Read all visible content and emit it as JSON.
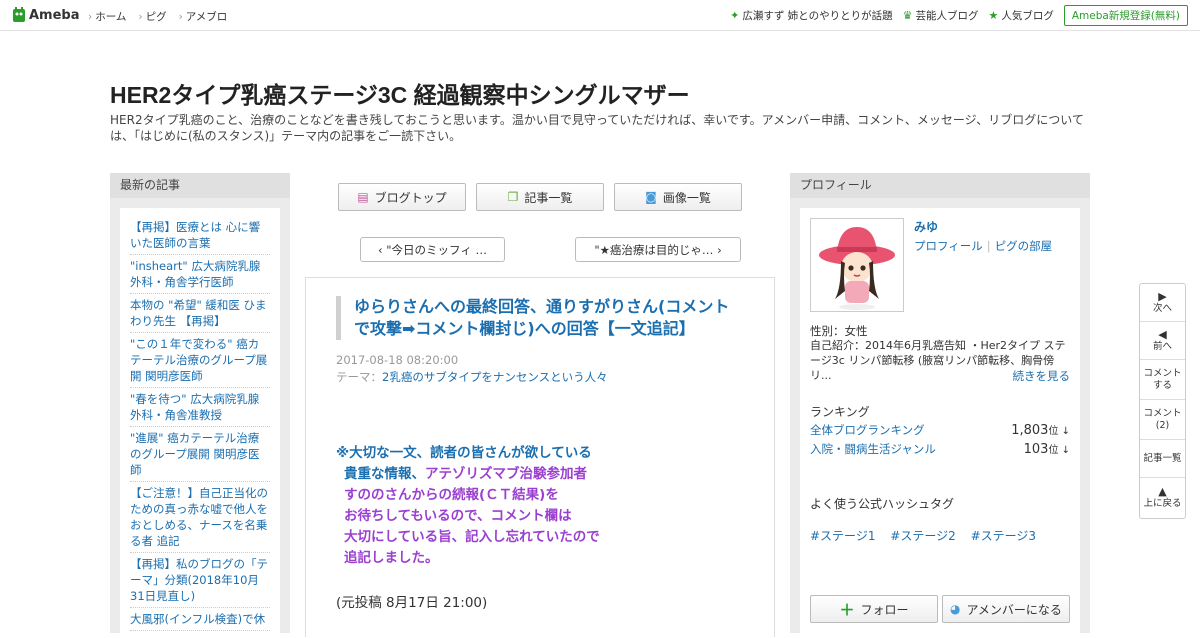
{
  "topbar": {
    "logo": "Ameba",
    "nav": [
      "ホーム",
      "ピグ",
      "アメブロ"
    ],
    "right_items": [
      {
        "icon": "sparkle-icon",
        "label": "広瀬すず 姉とのやりとりが話題"
      },
      {
        "icon": "crown-icon",
        "label": "芸能人ブログ"
      },
      {
        "icon": "star-icon",
        "label": "人気ブログ"
      }
    ],
    "register": "Ameba新規登録(無料)"
  },
  "blog": {
    "title": "HER2タイプ乳癌ステージ3C 経過観察中シングルマザー",
    "description": "HER2タイプ乳癌のこと、治療のことなどを書き残しておこうと思います。温かい目で見守っていただければ、幸いです。アメンバー申請、コメント、メッセージ、リブログについては、「はじめに(私のスタンス)」テーマ内の記事をご一読下さい。"
  },
  "left": {
    "heading": "最新の記事",
    "items": [
      "【再掲】医療とは 心に響いた医師の言葉",
      "\"insheart\" 広大病院乳腺外科・角舎学行医師",
      "本物の \"希望\" 緩和医 ひまわり先生 【再掲】",
      "\"この１年で変わる\" 癌カテーテル治療のグループ展開 関明彦医師",
      "\"春を待つ\" 広大病院乳腺外科・角舎准教授",
      "\"進展\" 癌カテーテル治療のグループ展開 関明彦医師",
      "【ご注意！】自己正当化のための真っ赤な嘘で他人をおとしめる、ナースを名乗る者 追記",
      "【再掲】私のブログの「テーマ」分類(2018年10月31日見直し)",
      "大風邪(インフル検査)で休"
    ]
  },
  "center": {
    "buttons": [
      {
        "icon": "list-icon",
        "label": "ブログトップ"
      },
      {
        "icon": "copy-icon",
        "label": "記事一覧"
      },
      {
        "icon": "camera-icon",
        "label": "画像一覧"
      }
    ],
    "prev": "‹ \"今日のミッフィ …",
    "next": "\"★癌治療は目的じゃ… ›",
    "article": {
      "title": "ゆらりさんへの最終回答、通りすがりさん(コメントで攻撃➡コメント欄封じ)への回答【一文追記】",
      "date": "2017-08-18 08:20:00",
      "theme_label": "テーマ：",
      "theme": "2乳癌のサブタイプをナンセンスという人々",
      "body": {
        "line1": "※大切な一文、読者の皆さんが欲している",
        "line2a": "貴重な情報、",
        "line2b": "アテゾリズマブ治験参加者",
        "line3": "すののさんからの続報(ＣＴ結果)を",
        "line4": "お待ちしてもいるので、コメント欄は",
        "line5": "大切にしている旨、記入し忘れていたので",
        "line6": "追記しました。"
      },
      "original": "(元投稿  8月17日  21:00)"
    }
  },
  "right": {
    "heading": "プロフィール",
    "name": "みゆ",
    "link_profile": "プロフィール",
    "link_pig": "ピグの部屋",
    "gender": "性別：女性",
    "intro": "自己紹介：2014年6月乳癌告知 ・Her2タイプ ステージ3c リンパ節転移 (腋窩リンパ節転移、胸骨傍リ...",
    "more": "続きを見る",
    "ranking_head": "ランキング",
    "ranking": [
      {
        "label": "全体ブログランキング",
        "value": "1,803",
        "unit": "位 ↓"
      },
      {
        "label": "入院・闘病生活ジャンル",
        "value": "103",
        "unit": "位 ↓"
      }
    ],
    "hashtag_head": "よく使う公式ハッシュタグ",
    "hashtags": [
      "#ステージ1",
      "#ステージ2",
      "#ステージ3"
    ],
    "follow": "フォロー",
    "amember": "アメンバーになる"
  },
  "sidenav": {
    "next": "次へ",
    "prev": "前へ",
    "comment_line1": "コメント",
    "comment_line2": "する",
    "comments_line1": "コメント",
    "comments_line2": "(2)",
    "list": "記事一覧",
    "top": "上に戻る"
  },
  "colors": {
    "link": "#1b6fb0",
    "accent_green": "#2a9d2a",
    "purple": "#9b3fd0"
  }
}
